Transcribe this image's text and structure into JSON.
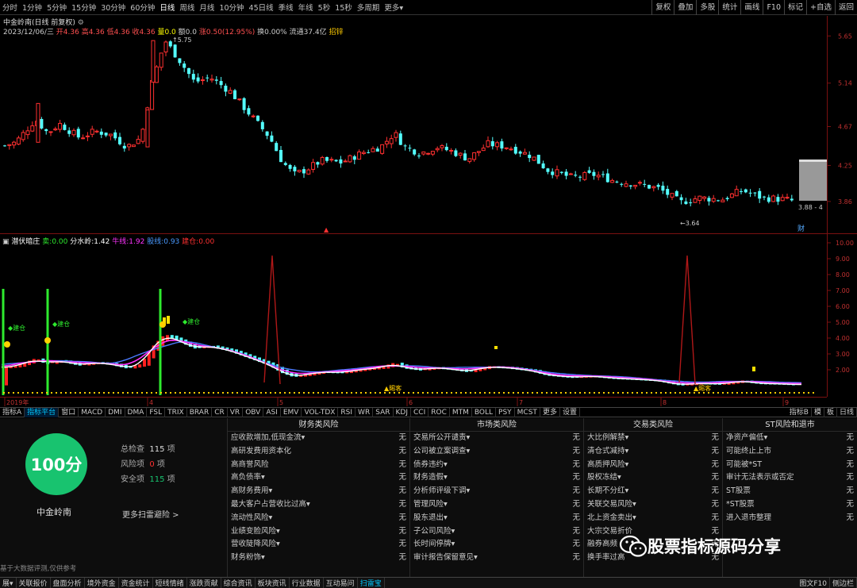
{
  "toolbar": {
    "periods": [
      "分时",
      "1分钟",
      "5分钟",
      "15分钟",
      "30分钟",
      "60分钟",
      "日线",
      "周线",
      "月线",
      "10分钟",
      "45日线",
      "季线",
      "年线",
      "5秒",
      "15秒",
      "多周期",
      "更多▾"
    ],
    "active_period": "日线",
    "right": [
      "复权",
      "叠加",
      "多股",
      "统计",
      "画线",
      "F10",
      "标记",
      "+自选",
      "返回"
    ]
  },
  "stock": {
    "title": "中金岭南(日线 前复权)",
    "info_date": "2023/12/06/三",
    "info_open": "开4.36",
    "info_high": "高4.36",
    "info_low": "低4.36",
    "info_close": "收4.36",
    "info_vol": "量0.0",
    "info_change": "额0.0",
    "info_amp": "涨0.50(12.95%)",
    "info_turnover": "换0.00%",
    "info_float": "流通37.4亿",
    "info_extra": "招锌",
    "name": "中金岭南"
  },
  "price_axis": [
    "5.65",
    "5.14",
    "4.67",
    "4.25",
    "3.86"
  ],
  "price_high_label": "5.75",
  "price_low_label": "3.64",
  "price_current_label": "3.88 - 4",
  "fin_badge": "财",
  "indicator": {
    "name": "潜伏暗庄",
    "sell_label": "卖:",
    "sell_val": "0.00",
    "water_label": "分水岭:",
    "water_val": "1.42",
    "ox_label": "牛线:",
    "ox_val": "1.92",
    "control_label": "股线:",
    "control_val": "0.93",
    "buy_label": "建仓:",
    "buy_val": "0.00",
    "axis": [
      "10.00",
      "9.00",
      "8.00",
      "7.00",
      "6.00",
      "5.00",
      "4.00",
      "3.00",
      "2.00"
    ],
    "annotations": [
      "建仓",
      "建仓",
      "建仓"
    ],
    "signal_labels": [
      "賜客",
      "賜客"
    ]
  },
  "timeline": {
    "labels": [
      "2019年",
      "4",
      "5",
      "6",
      "7",
      "8",
      "9"
    ]
  },
  "tabs": [
    "指标A",
    "指标平台",
    "窗口",
    "MACD",
    "DMI",
    "DMA",
    "FSL",
    "TRIX",
    "BRAR",
    "CR",
    "VR",
    "OBV",
    "ASI",
    "EMV",
    "VOL-TDX",
    "RSI",
    "WR",
    "SAR",
    "KDJ",
    "CCI",
    "ROC",
    "MTM",
    "BOLL",
    "PSY",
    "MCST",
    "更多",
    "设置"
  ],
  "tabs_right": [
    "指标B",
    "模",
    "板",
    "日线"
  ],
  "risk": {
    "score": "100分",
    "total_label": "总检查",
    "total_val": "115",
    "unit": "项",
    "risk_label": "风险项",
    "risk_val": "0",
    "safe_label": "安全项",
    "safe_val": "115",
    "stock_name": "中金岭南",
    "more_link": "更多扫雷避险 >",
    "disclaimer": "基于大数据评测,仅供参考"
  },
  "columns": [
    {
      "title": "财务类风险",
      "items": [
        "应收款增加,低现金流▾",
        "高研发费用资本化",
        "高商誉风险",
        "高负债率▾",
        "高财务费用▾",
        "最大客户占营收比过高▾",
        "流动性风险▾",
        "业绩变脸风险▾",
        "营收陡降风险▾",
        "财务粉饰▾"
      ]
    },
    {
      "title": "市场类风险",
      "items": [
        "交易所公开谴责▾",
        "公司被立案调查▾",
        "债券违约▾",
        "财务造假▾",
        "分析师评级下调▾",
        "管理风险▾",
        "股东退出▾",
        "子公司风险▾",
        "长时间停牌▾",
        "审计报告保留意见▾"
      ]
    },
    {
      "title": "交易类风险",
      "items": [
        "大比例解禁▾",
        "清仓式减持▾",
        "高质押风险▾",
        "股权冻结▾",
        "长期不分红▾",
        "关联交易风险▾",
        "北上资金卖出▾",
        "大宗交易折价",
        "融券高频",
        "换手率过高"
      ]
    },
    {
      "title": "ST风险和退市",
      "items": [
        "净资产偏低▾",
        "可能终止上市",
        "可能被*ST",
        "审计无法表示或否定",
        "ST股票",
        "*ST股票",
        "进入退市整理"
      ]
    }
  ],
  "no_value": "无",
  "bottom_tabs": [
    "展▾",
    "关联报价",
    "盘面分析",
    "境外资金",
    "资金统计",
    "短线情绪",
    "涨跌贡献",
    "综合资讯",
    "板块资讯",
    "行业数据",
    "互动易问",
    "扫雷宝"
  ],
  "bottom_right": "图文F10",
  "bottom_right2": "侧边栏",
  "watermark": "股票指标源码分享",
  "colors": {
    "up": "#ff3030",
    "down": "#54ffff",
    "score_green": "#18c36f",
    "signal_green": "#2eea2e",
    "ma_white": "#ffffff",
    "ma_magenta": "#ff33ff",
    "ma_blue": "#4a7aff"
  }
}
